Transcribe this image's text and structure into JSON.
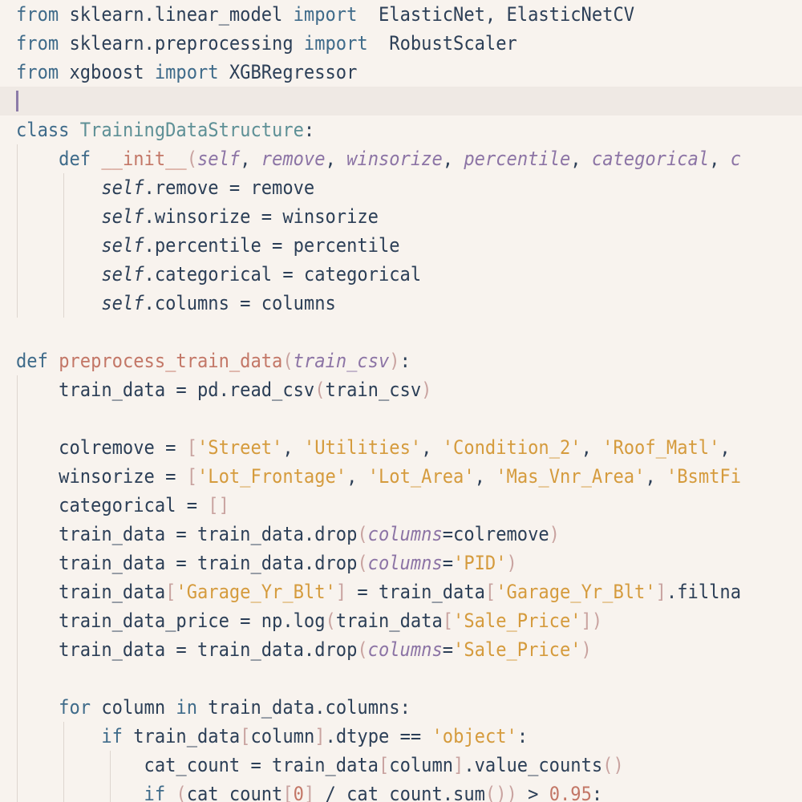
{
  "editor": {
    "language": "python",
    "theme": {
      "background": "#f8f3ee",
      "current_line": "#efe9e4",
      "caret": "#8c7ba8",
      "keyword": "#3f6b8a",
      "string": "#d59b3d",
      "function": "#c37767",
      "parameter": "#8c74a5",
      "class_name": "#5e9096"
    },
    "current_line_index": 3,
    "lines": [
      [
        {
          "t": "kw",
          "v": "from"
        },
        {
          "t": "text",
          "v": " sklearn.linear_model "
        },
        {
          "t": "kw",
          "v": "import"
        },
        {
          "t": "text",
          "v": "  ElasticNet, ElasticNetCV"
        }
      ],
      [
        {
          "t": "kw",
          "v": "from"
        },
        {
          "t": "text",
          "v": " sklearn.preprocessing "
        },
        {
          "t": "kw",
          "v": "import"
        },
        {
          "t": "text",
          "v": "  RobustScaler"
        }
      ],
      [
        {
          "t": "kw",
          "v": "from"
        },
        {
          "t": "text",
          "v": " xgboost "
        },
        {
          "t": "kw",
          "v": "import"
        },
        {
          "t": "text",
          "v": " XGBRegressor"
        }
      ],
      [],
      [
        {
          "t": "kw",
          "v": "class"
        },
        {
          "t": "text",
          "v": " "
        },
        {
          "t": "class",
          "v": "TrainingDataStructure"
        },
        {
          "t": "op",
          "v": ":"
        }
      ],
      [
        {
          "t": "text",
          "v": "    "
        },
        {
          "t": "kw",
          "v": "def"
        },
        {
          "t": "text",
          "v": " "
        },
        {
          "t": "func",
          "v": "__init__"
        },
        {
          "t": "paren",
          "v": "("
        },
        {
          "t": "param",
          "v": "self"
        },
        {
          "t": "op",
          "v": ", "
        },
        {
          "t": "param",
          "v": "remove"
        },
        {
          "t": "op",
          "v": ", "
        },
        {
          "t": "param",
          "v": "winsorize"
        },
        {
          "t": "op",
          "v": ", "
        },
        {
          "t": "param",
          "v": "percentile"
        },
        {
          "t": "op",
          "v": ", "
        },
        {
          "t": "param",
          "v": "categorical"
        },
        {
          "t": "op",
          "v": ", "
        },
        {
          "t": "param",
          "v": "c"
        }
      ],
      [
        {
          "t": "text",
          "v": "        "
        },
        {
          "t": "self",
          "v": "self"
        },
        {
          "t": "text",
          "v": ".remove = remove"
        }
      ],
      [
        {
          "t": "text",
          "v": "        "
        },
        {
          "t": "self",
          "v": "self"
        },
        {
          "t": "text",
          "v": ".winsorize = winsorize"
        }
      ],
      [
        {
          "t": "text",
          "v": "        "
        },
        {
          "t": "self",
          "v": "self"
        },
        {
          "t": "text",
          "v": ".percentile = percentile"
        }
      ],
      [
        {
          "t": "text",
          "v": "        "
        },
        {
          "t": "self",
          "v": "self"
        },
        {
          "t": "text",
          "v": ".categorical = categorical"
        }
      ],
      [
        {
          "t": "text",
          "v": "        "
        },
        {
          "t": "self",
          "v": "self"
        },
        {
          "t": "text",
          "v": ".columns = columns"
        }
      ],
      [],
      [
        {
          "t": "kw",
          "v": "def"
        },
        {
          "t": "text",
          "v": " "
        },
        {
          "t": "func",
          "v": "preprocess_train_data"
        },
        {
          "t": "paren",
          "v": "("
        },
        {
          "t": "param",
          "v": "train_csv"
        },
        {
          "t": "paren",
          "v": ")"
        },
        {
          "t": "op",
          "v": ":"
        }
      ],
      [
        {
          "t": "text",
          "v": "    train_data = pd.read_csv"
        },
        {
          "t": "paren",
          "v": "("
        },
        {
          "t": "text",
          "v": "train_csv"
        },
        {
          "t": "paren",
          "v": ")"
        }
      ],
      [],
      [
        {
          "t": "text",
          "v": "    colremove = "
        },
        {
          "t": "paren",
          "v": "["
        },
        {
          "t": "string",
          "v": "'Street'"
        },
        {
          "t": "op",
          "v": ", "
        },
        {
          "t": "string",
          "v": "'Utilities'"
        },
        {
          "t": "op",
          "v": ", "
        },
        {
          "t": "string",
          "v": "'Condition_2'"
        },
        {
          "t": "op",
          "v": ", "
        },
        {
          "t": "string",
          "v": "'Roof_Matl'"
        },
        {
          "t": "op",
          "v": ", "
        }
      ],
      [
        {
          "t": "text",
          "v": "    winsorize = "
        },
        {
          "t": "paren",
          "v": "["
        },
        {
          "t": "string",
          "v": "'Lot_Frontage'"
        },
        {
          "t": "op",
          "v": ", "
        },
        {
          "t": "string",
          "v": "'Lot_Area'"
        },
        {
          "t": "op",
          "v": ", "
        },
        {
          "t": "string",
          "v": "'Mas_Vnr_Area'"
        },
        {
          "t": "op",
          "v": ", "
        },
        {
          "t": "string",
          "v": "'BsmtFi"
        }
      ],
      [
        {
          "t": "text",
          "v": "    categorical = "
        },
        {
          "t": "paren",
          "v": "[]"
        }
      ],
      [
        {
          "t": "text",
          "v": "    train_data = train_data.drop"
        },
        {
          "t": "paren",
          "v": "("
        },
        {
          "t": "param",
          "v": "columns"
        },
        {
          "t": "op",
          "v": "="
        },
        {
          "t": "text",
          "v": "colremove"
        },
        {
          "t": "paren",
          "v": ")"
        }
      ],
      [
        {
          "t": "text",
          "v": "    train_data = train_data.drop"
        },
        {
          "t": "paren",
          "v": "("
        },
        {
          "t": "param",
          "v": "columns"
        },
        {
          "t": "op",
          "v": "="
        },
        {
          "t": "string",
          "v": "'PID'"
        },
        {
          "t": "paren",
          "v": ")"
        }
      ],
      [
        {
          "t": "text",
          "v": "    train_data"
        },
        {
          "t": "paren",
          "v": "["
        },
        {
          "t": "string",
          "v": "'Garage_Yr_Blt'"
        },
        {
          "t": "paren",
          "v": "]"
        },
        {
          "t": "text",
          "v": " = train_data"
        },
        {
          "t": "paren",
          "v": "["
        },
        {
          "t": "string",
          "v": "'Garage_Yr_Blt'"
        },
        {
          "t": "paren",
          "v": "]"
        },
        {
          "t": "text",
          "v": ".fillna"
        }
      ],
      [
        {
          "t": "text",
          "v": "    train_data_price = np.log"
        },
        {
          "t": "paren",
          "v": "("
        },
        {
          "t": "text",
          "v": "train_data"
        },
        {
          "t": "paren",
          "v": "["
        },
        {
          "t": "string",
          "v": "'Sale_Price'"
        },
        {
          "t": "paren",
          "v": "])"
        }
      ],
      [
        {
          "t": "text",
          "v": "    train_data = train_data.drop"
        },
        {
          "t": "paren",
          "v": "("
        },
        {
          "t": "param",
          "v": "columns"
        },
        {
          "t": "op",
          "v": "="
        },
        {
          "t": "string",
          "v": "'Sale_Price'"
        },
        {
          "t": "paren",
          "v": ")"
        }
      ],
      [],
      [
        {
          "t": "text",
          "v": "    "
        },
        {
          "t": "kw",
          "v": "for"
        },
        {
          "t": "text",
          "v": " column "
        },
        {
          "t": "kw",
          "v": "in"
        },
        {
          "t": "text",
          "v": " train_data.columns:"
        }
      ],
      [
        {
          "t": "text",
          "v": "        "
        },
        {
          "t": "kw",
          "v": "if"
        },
        {
          "t": "text",
          "v": " train_data"
        },
        {
          "t": "paren",
          "v": "["
        },
        {
          "t": "text",
          "v": "column"
        },
        {
          "t": "paren",
          "v": "]"
        },
        {
          "t": "text",
          "v": ".dtype == "
        },
        {
          "t": "string",
          "v": "'object'"
        },
        {
          "t": "op",
          "v": ":"
        }
      ],
      [
        {
          "t": "text",
          "v": "            cat_count = train_data"
        },
        {
          "t": "paren",
          "v": "["
        },
        {
          "t": "text",
          "v": "column"
        },
        {
          "t": "paren",
          "v": "]"
        },
        {
          "t": "text",
          "v": ".value_counts"
        },
        {
          "t": "paren",
          "v": "()"
        }
      ],
      [
        {
          "t": "text",
          "v": "            "
        },
        {
          "t": "kw",
          "v": "if"
        },
        {
          "t": "text",
          "v": " "
        },
        {
          "t": "paren",
          "v": "("
        },
        {
          "t": "text",
          "v": "cat_count"
        },
        {
          "t": "paren",
          "v": "["
        },
        {
          "t": "number",
          "v": "0"
        },
        {
          "t": "paren",
          "v": "]"
        },
        {
          "t": "text",
          "v": " / cat_count.sum"
        },
        {
          "t": "paren",
          "v": "())"
        },
        {
          "t": "text",
          "v": " > "
        },
        {
          "t": "number",
          "v": "0.95"
        },
        {
          "t": "op",
          "v": ":"
        }
      ]
    ]
  }
}
